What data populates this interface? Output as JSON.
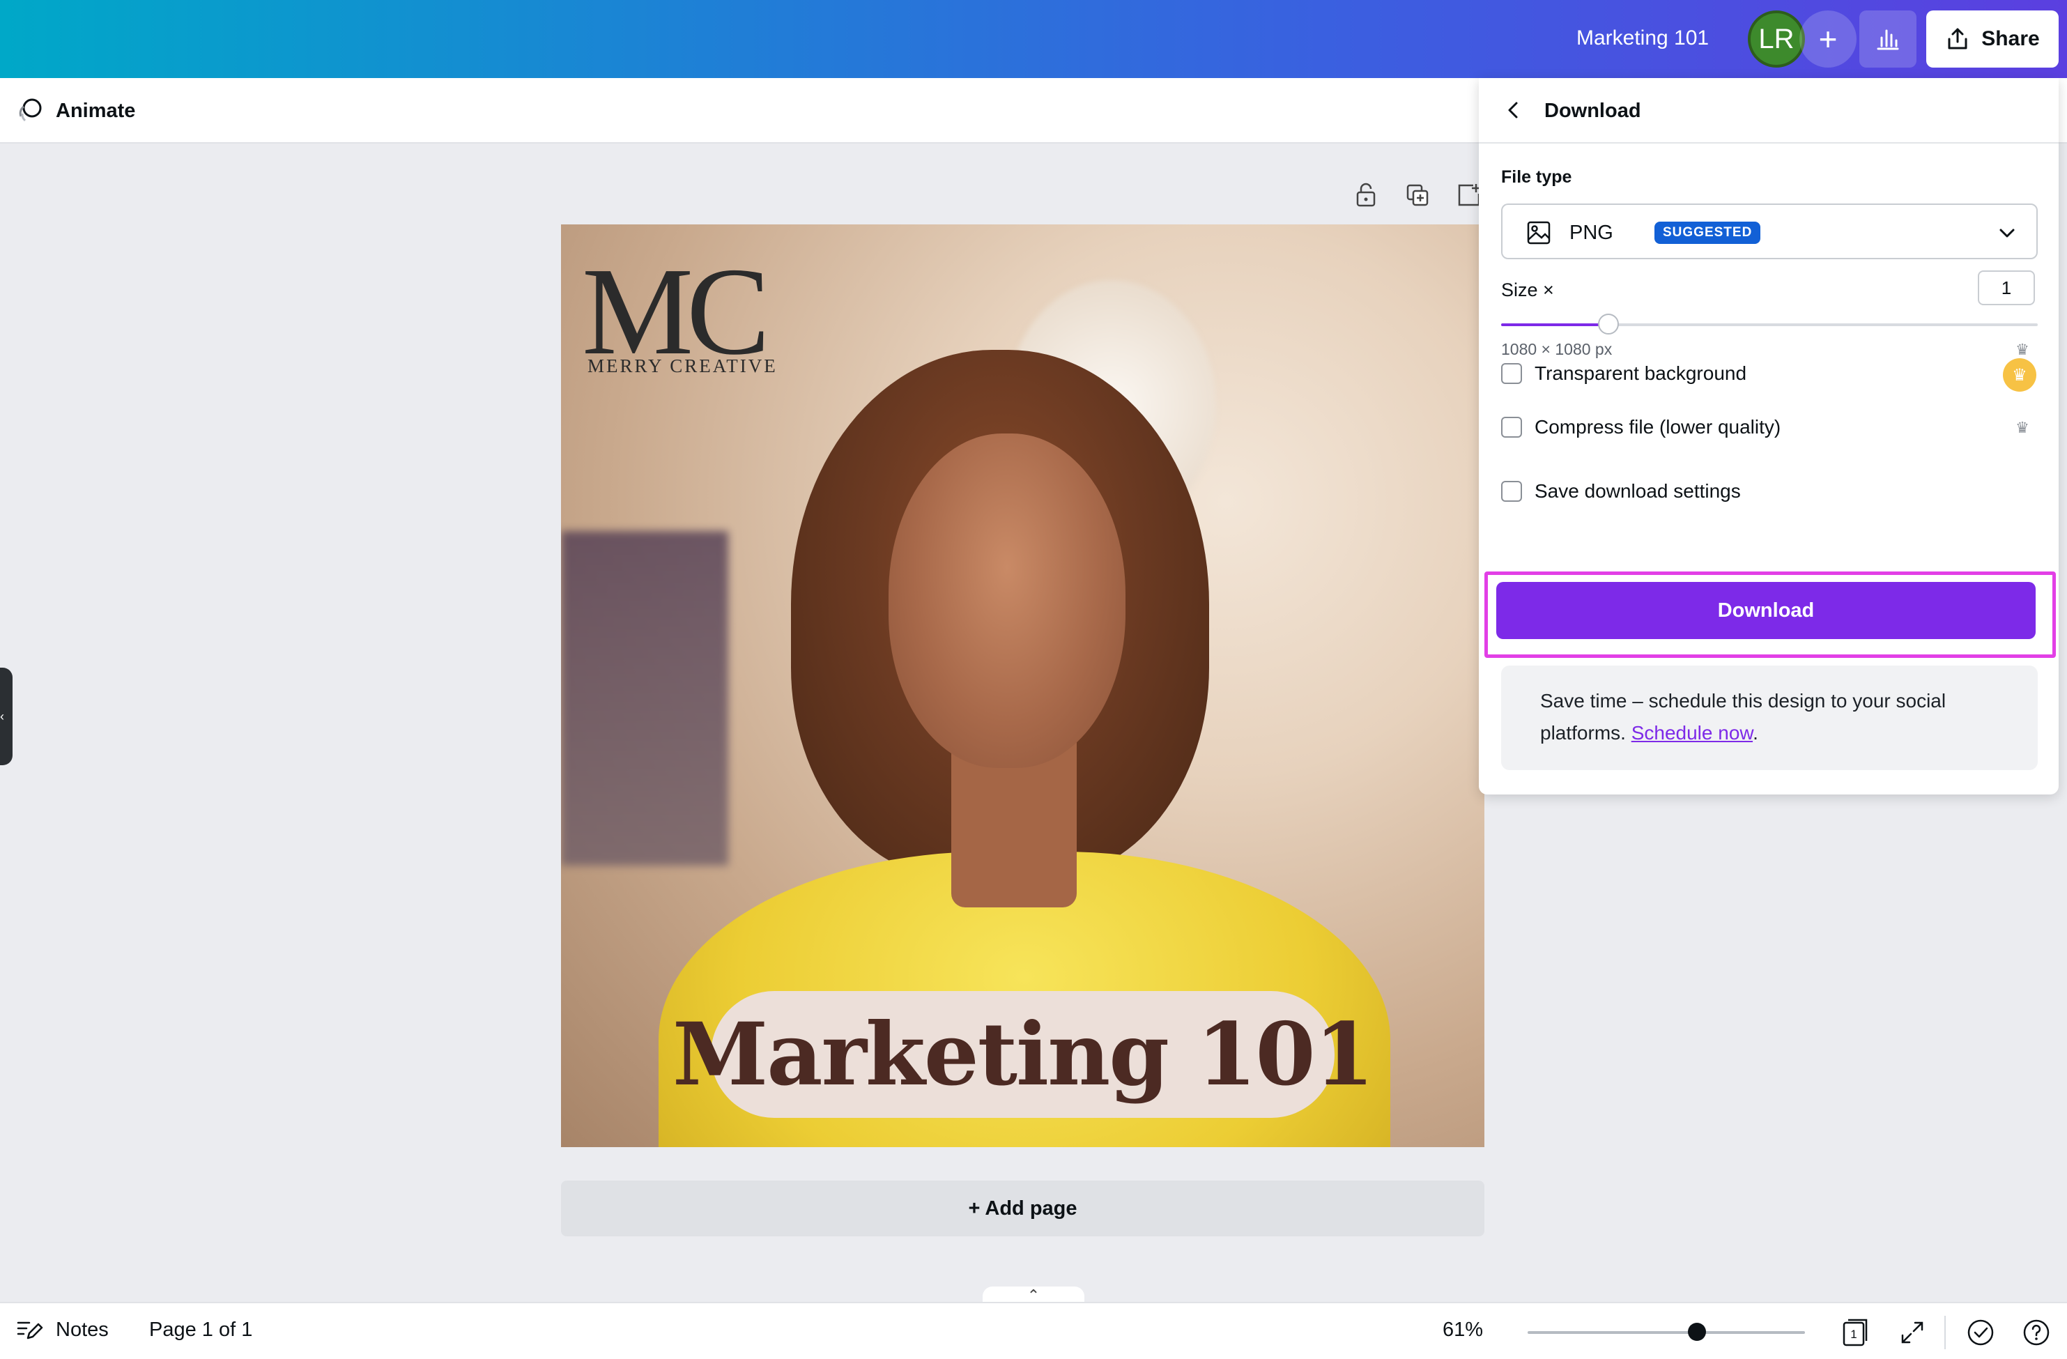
{
  "header": {
    "doc_title": "Marketing 101",
    "avatar_initials": "LR",
    "add_collaborator_icon": "plus-icon",
    "insights_icon": "bar-chart-icon",
    "share_label": "Share"
  },
  "toolbar": {
    "animate_label": "Animate"
  },
  "canvas": {
    "logo_monogram": "MC",
    "logo_text": "MERRY CREATIVE",
    "headline": "Marketing 101",
    "add_page_label": "+ Add page"
  },
  "download_panel": {
    "title": "Download",
    "file_type_label": "File type",
    "file_type_value": "PNG",
    "file_type_badge": "SUGGESTED",
    "size_label": "Size ×",
    "size_value": "1",
    "size_slider_fraction": 0.2,
    "dimensions": "1080 × 1080 px",
    "options": [
      {
        "label": "Transparent background",
        "checked": false
      },
      {
        "label": "Compress file (lower quality)",
        "checked": false
      },
      {
        "label": "Save download settings",
        "checked": false
      }
    ],
    "download_button": "Download",
    "promo_text": "Save time – schedule this design to your social platforms. ",
    "promo_link": "Schedule now",
    "promo_end": ".",
    "colors": {
      "accent": "#7d2ae8",
      "highlight": "#e23fe6",
      "badge": "#1260d6"
    }
  },
  "footer": {
    "notes_label": "Notes",
    "page_indicator": "Page 1 of 1",
    "zoom_label": "61%",
    "zoom_fraction": 0.61,
    "page_count": "1"
  }
}
